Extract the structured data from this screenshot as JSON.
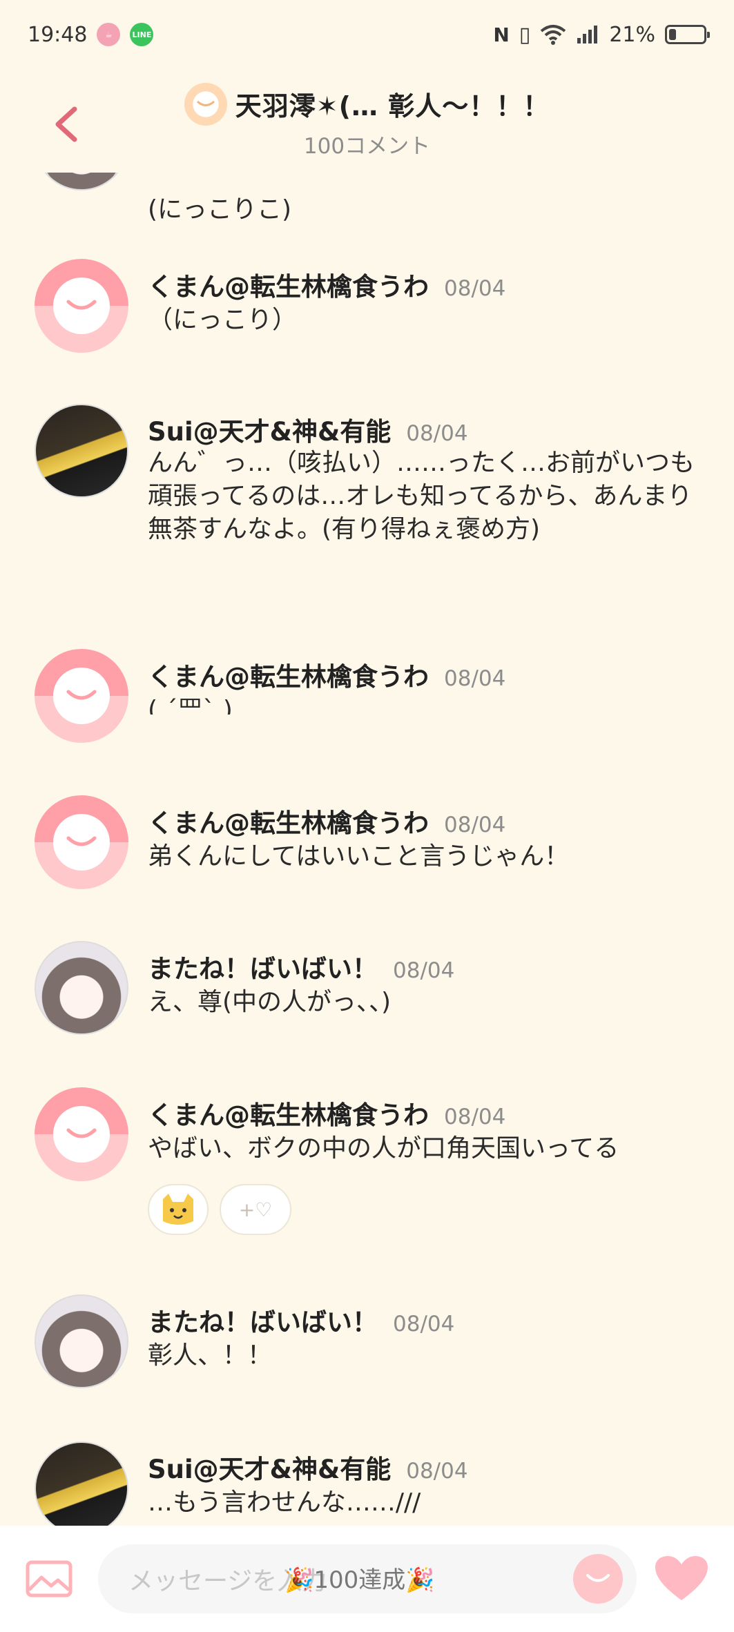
{
  "status_bar": {
    "time": "19:48",
    "battery": "21%",
    "battery_level": 0.21,
    "icons": [
      "cup-app-icon",
      "line-app-icon",
      "nfc-icon",
      "vibrate-icon",
      "wifi-icon",
      "signal-icon",
      "battery-icon"
    ]
  },
  "header": {
    "title": "天羽澪✶(… 彰人〜！！！",
    "subtitle": "100コメント"
  },
  "messages": [
    {
      "name": "",
      "date": "",
      "text": "(にっこりこ)",
      "avatar": "matane",
      "partial": true
    },
    {
      "name": "くまん@転生林檎食うわ",
      "date": "08/04",
      "text": "（にっこり）",
      "avatar": "default"
    },
    {
      "name": "Sui@天才&神&有能",
      "date": "08/04",
      "text": "んん゛っ…（咳払い）……ったく…お前がいつも頑張ってるのは…オレも知ってるから、あんまり無茶すんなよ。(有り得ねぇ褒め方)",
      "avatar": "sui"
    },
    {
      "name": "くまん@転生林檎食うわ",
      "date": "08/04",
      "text": "( ´罒` )",
      "avatar": "default"
    },
    {
      "name": "くまん@転生林檎食うわ",
      "date": "08/04",
      "text": "弟くんにしてはいいこと言うじゃん！",
      "avatar": "default"
    },
    {
      "name": "またね！ばいばい！",
      "date": "08/04",
      "text": "え、尊(中の人がっ、、)",
      "avatar": "matane"
    },
    {
      "name": "くまん@転生林檎食うわ",
      "date": "08/04",
      "text": "やばい、ボクの中の人が口角天国いってる",
      "avatar": "default"
    },
    {
      "name": "またね！ばいばい！",
      "date": "08/04",
      "text": "彰人、！！",
      "avatar": "matane"
    },
    {
      "name": "Sui@天才&神&有能",
      "date": "08/04",
      "text": "…もう言わせんな……///",
      "avatar": "sui"
    }
  ],
  "reactions": {
    "emoji": "cat-face",
    "add_label": "+♡"
  },
  "bottom_bar": {
    "input_placeholder": "メッセージを入力",
    "badge": "🎉100達成🎉"
  },
  "colors": {
    "background": "#fdf8e9",
    "accent_pink": "#ff9fa8",
    "back_arrow": "#e06a78"
  }
}
